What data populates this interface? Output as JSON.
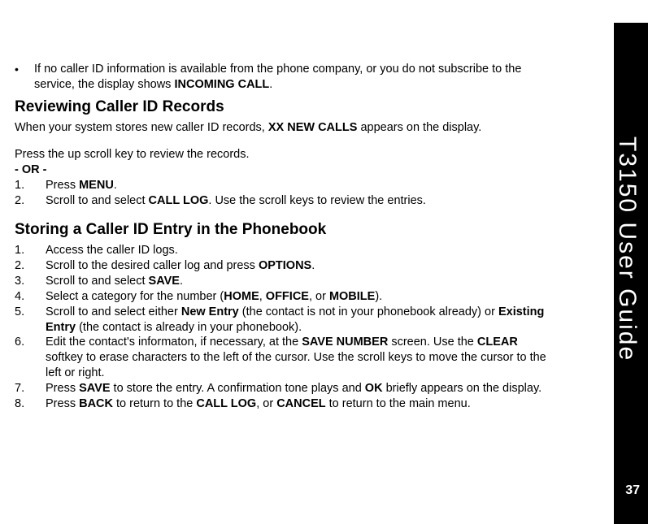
{
  "sidebar": {
    "title": "T3150 User Guide",
    "page_number": "37"
  },
  "bullet": {
    "text_part1": "If no caller ID information is available from the phone company, or you do not subscribe to the service, the display shows ",
    "text_bold": "INCOMING CALL",
    "text_part2": "."
  },
  "section1": {
    "heading": "Reviewing Caller ID Records",
    "intro_part1": "When your system stores new caller ID records, ",
    "intro_bold": "XX NEW CALLS",
    "intro_part2": " appears on the display.",
    "pre_list": "Press the up scroll key to review the records.",
    "or_text": "- OR -",
    "items": [
      {
        "num": "1.",
        "p1": "Press ",
        "b1": "MENU",
        "p2": "."
      },
      {
        "num": "2.",
        "p1": "Scroll to and select ",
        "b1": "CALL LOG",
        "p2": ". Use the scroll keys to review the entries."
      }
    ]
  },
  "section2": {
    "heading": "Storing a Caller ID Entry in the Phonebook",
    "items": [
      {
        "num": "1.",
        "text": "Access the caller ID logs."
      },
      {
        "num": "2.",
        "p1": "Scroll to the desired caller log and press ",
        "b1": "OPTIONS",
        "p2": "."
      },
      {
        "num": "3.",
        "p1": "Scroll to and select ",
        "b1": "SAVE",
        "p2": "."
      },
      {
        "num": "4.",
        "p1": "Select a category for the number (",
        "b1": "HOME",
        "p2": ", ",
        "b2": "OFFICE",
        "p3": ", or ",
        "b3": "MOBILE",
        "p4": ")."
      },
      {
        "num": "5.",
        "p1": "Scroll to and select either ",
        "b1": "New Entry",
        "p2": " (the contact is not in your phonebook already) or ",
        "b2": "Existing Entry",
        "p3": " (the contact is already in your phonebook)."
      },
      {
        "num": "6.",
        "p1": "Edit the contact's informaton, if necessary, at the ",
        "b1": "SAVE NUMBER",
        "p2": " screen. Use the ",
        "b2": "CLEAR",
        "p3": " softkey to erase characters to the left of the cursor. Use the scroll keys to move the cursor to the left or right."
      },
      {
        "num": "7.",
        "p1": "Press ",
        "b1": "SAVE",
        "p2": " to store the entry. A confirmation tone plays and ",
        "b2": "OK",
        "p3": " briefly appears on the display."
      },
      {
        "num": "8.",
        "p1": "Press ",
        "b1": "BACK",
        "p2": " to return to the ",
        "b2": "CALL LOG",
        "p3": ", or ",
        "b3": "CANCEL",
        "p4": " to return to the main menu."
      }
    ]
  }
}
